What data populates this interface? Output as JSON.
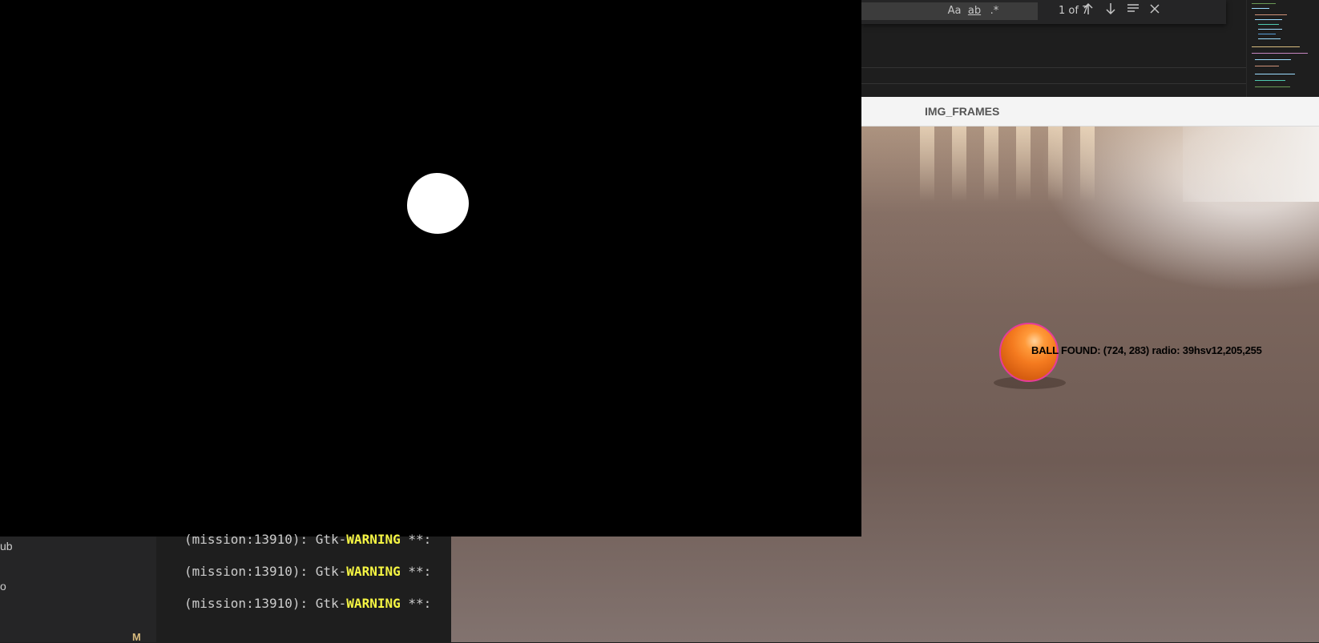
{
  "find_widget": {
    "match_case_label": "Aa",
    "whole_word_label": "ab",
    "regex_label": ".*",
    "match_count": "1 of 7",
    "prev_icon": "arrow-up-icon",
    "next_icon": "arrow-down-icon",
    "selection_icon": "find-in-selection-icon",
    "close_icon": "close-icon"
  },
  "frames_window": {
    "title": "IMG_FRAMES",
    "detection_text": "BALL FOUND: (724, 283) radio: 39hsv12,205,255",
    "circle_color": "#e63c9a",
    "ball_color": "#f47a1f"
  },
  "sidebar": {
    "item_1_fragment": "ub",
    "item_2_fragment": "o",
    "badge": "M",
    "badge_color": "#d7ba7d"
  },
  "terminal": {
    "lines": [
      {
        "prefix": "(mission:13910): Gtk-",
        "level": "WARNING",
        "suffix": " **: "
      },
      {
        "prefix": "(mission:13910): Gtk-",
        "level": "WARNING",
        "suffix": " **: "
      },
      {
        "prefix": "(mission:13910): Gtk-",
        "level": "WARNING",
        "suffix": " **: "
      }
    ],
    "warning_color": "#f5f543"
  }
}
